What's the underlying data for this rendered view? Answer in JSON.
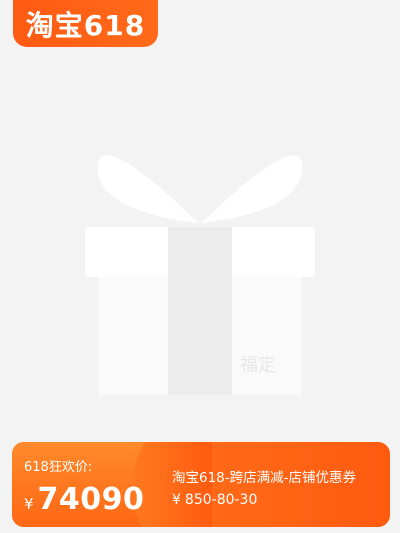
{
  "brand": {
    "logo_text": "淘宝618"
  },
  "placeholder": {
    "stamp_text": "福定"
  },
  "price_block": {
    "label": "618狂欢价:",
    "currency": "¥",
    "value": "74090"
  },
  "promo": {
    "title": "淘宝618-跨店满减-店铺优惠券",
    "currency": "¥",
    "rule": "850-80-30"
  },
  "colors": {
    "accent": "#ff5a12",
    "background": "#f3f3f3",
    "gift": "#ffffff"
  }
}
